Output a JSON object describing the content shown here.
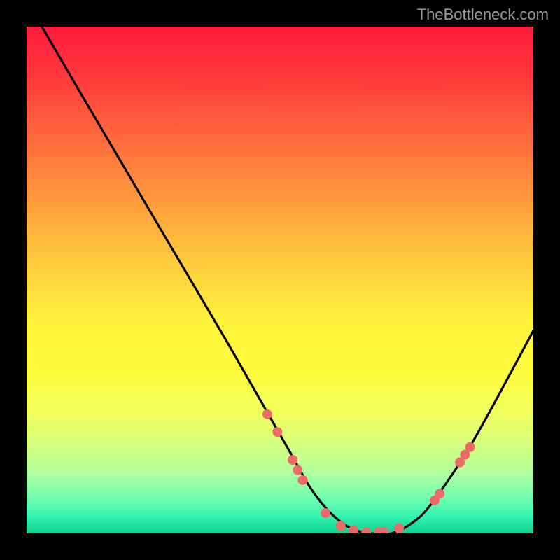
{
  "watermark": "TheBottleneck.com",
  "chart_data": {
    "type": "line",
    "title": "",
    "xlabel": "",
    "ylabel": "",
    "xlim": [
      0,
      100
    ],
    "ylim": [
      0,
      100
    ],
    "grid": false,
    "legend": false,
    "series": [
      {
        "name": "curve",
        "x": [
          3,
          10,
          20,
          30,
          40,
          48,
          52,
          56,
          60,
          64,
          68,
          72,
          76,
          80,
          88,
          100
        ],
        "y": [
          100,
          88,
          71,
          54,
          37,
          23,
          16,
          9,
          4,
          1,
          0,
          0,
          2,
          6,
          18,
          40
        ],
        "color": "#000000"
      }
    ],
    "markers": [
      {
        "x": 47.5,
        "y": 23.5
      },
      {
        "x": 49.5,
        "y": 20.0
      },
      {
        "x": 52.5,
        "y": 14.5
      },
      {
        "x": 53.5,
        "y": 12.5
      },
      {
        "x": 54.5,
        "y": 10.5
      },
      {
        "x": 59.0,
        "y": 4.0
      },
      {
        "x": 62.0,
        "y": 1.5
      },
      {
        "x": 64.5,
        "y": 0.6
      },
      {
        "x": 67.0,
        "y": 0.2
      },
      {
        "x": 69.5,
        "y": 0.2
      },
      {
        "x": 70.5,
        "y": 0.3
      },
      {
        "x": 73.5,
        "y": 1.0
      },
      {
        "x": 80.5,
        "y": 6.5
      },
      {
        "x": 81.5,
        "y": 7.8
      },
      {
        "x": 85.5,
        "y": 14.0
      },
      {
        "x": 86.5,
        "y": 15.5
      },
      {
        "x": 87.5,
        "y": 17.0
      }
    ],
    "marker_color": "#ec6b66",
    "marker_radius": 7
  }
}
